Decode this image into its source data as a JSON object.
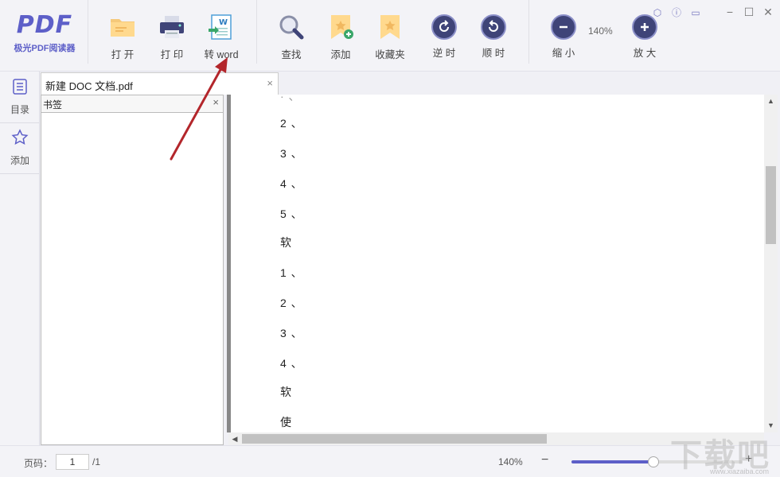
{
  "app": {
    "logo_mark": "PDF",
    "logo_sub": "极光PDF阅读器"
  },
  "toolbar": {
    "open": "打 开",
    "print": "打 印",
    "to_word": "转 word",
    "find": "查找",
    "add": "添加",
    "favorites": "收藏夹",
    "rotate_ccw": "逆 时",
    "rotate_cw": "顺 时",
    "zoom_out": "缩 小",
    "zoom_level": "140%",
    "zoom_in": "放 大"
  },
  "rail": {
    "toc": "目录",
    "add": "添加"
  },
  "tab": {
    "title": "新建 DOC 文档.pdf",
    "close": "×"
  },
  "bookmark_panel": {
    "title": "书签",
    "close": "×"
  },
  "document": {
    "lines": [
      "2 、",
      "3 、",
      "4 、",
      "5 、",
      "软",
      "1 、",
      "2 、",
      "3 、",
      "4 、",
      "软",
      "使"
    ]
  },
  "status": {
    "page_label": "页码：",
    "page_value": "1",
    "page_total": "/1",
    "zoom": "140%",
    "minus": "−",
    "plus": "+",
    "zoom_slider_fraction": 0.48
  },
  "watermark": {
    "text": "下载吧",
    "url": "www.xiazaiba.com"
  },
  "colors": {
    "accent": "#5d5fc8",
    "annotation_arrow": "#b3262b"
  }
}
